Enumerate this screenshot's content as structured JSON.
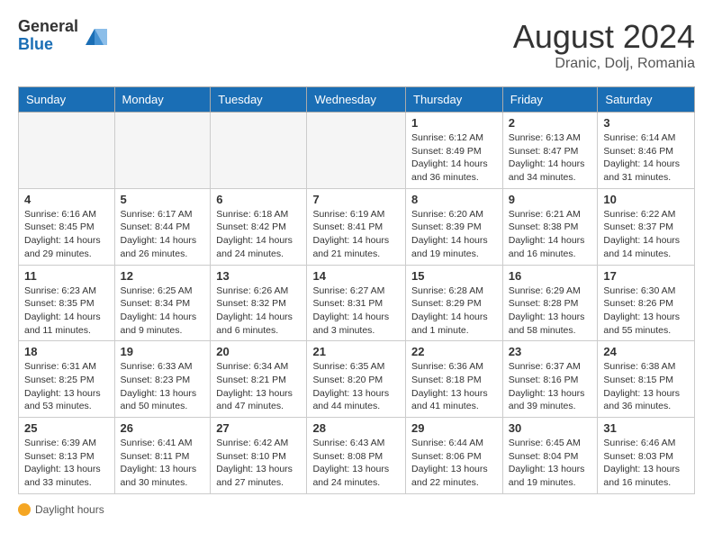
{
  "header": {
    "logo_general": "General",
    "logo_blue": "Blue",
    "month_year": "August 2024",
    "location": "Dranic, Dolj, Romania"
  },
  "calendar": {
    "days_of_week": [
      "Sunday",
      "Monday",
      "Tuesday",
      "Wednesday",
      "Thursday",
      "Friday",
      "Saturday"
    ],
    "weeks": [
      [
        {
          "day": "",
          "info": ""
        },
        {
          "day": "",
          "info": ""
        },
        {
          "day": "",
          "info": ""
        },
        {
          "day": "",
          "info": ""
        },
        {
          "day": "1",
          "info": "Sunrise: 6:12 AM\nSunset: 8:49 PM\nDaylight: 14 hours and 36 minutes."
        },
        {
          "day": "2",
          "info": "Sunrise: 6:13 AM\nSunset: 8:47 PM\nDaylight: 14 hours and 34 minutes."
        },
        {
          "day": "3",
          "info": "Sunrise: 6:14 AM\nSunset: 8:46 PM\nDaylight: 14 hours and 31 minutes."
        }
      ],
      [
        {
          "day": "4",
          "info": "Sunrise: 6:16 AM\nSunset: 8:45 PM\nDaylight: 14 hours and 29 minutes."
        },
        {
          "day": "5",
          "info": "Sunrise: 6:17 AM\nSunset: 8:44 PM\nDaylight: 14 hours and 26 minutes."
        },
        {
          "day": "6",
          "info": "Sunrise: 6:18 AM\nSunset: 8:42 PM\nDaylight: 14 hours and 24 minutes."
        },
        {
          "day": "7",
          "info": "Sunrise: 6:19 AM\nSunset: 8:41 PM\nDaylight: 14 hours and 21 minutes."
        },
        {
          "day": "8",
          "info": "Sunrise: 6:20 AM\nSunset: 8:39 PM\nDaylight: 14 hours and 19 minutes."
        },
        {
          "day": "9",
          "info": "Sunrise: 6:21 AM\nSunset: 8:38 PM\nDaylight: 14 hours and 16 minutes."
        },
        {
          "day": "10",
          "info": "Sunrise: 6:22 AM\nSunset: 8:37 PM\nDaylight: 14 hours and 14 minutes."
        }
      ],
      [
        {
          "day": "11",
          "info": "Sunrise: 6:23 AM\nSunset: 8:35 PM\nDaylight: 14 hours and 11 minutes."
        },
        {
          "day": "12",
          "info": "Sunrise: 6:25 AM\nSunset: 8:34 PM\nDaylight: 14 hours and 9 minutes."
        },
        {
          "day": "13",
          "info": "Sunrise: 6:26 AM\nSunset: 8:32 PM\nDaylight: 14 hours and 6 minutes."
        },
        {
          "day": "14",
          "info": "Sunrise: 6:27 AM\nSunset: 8:31 PM\nDaylight: 14 hours and 3 minutes."
        },
        {
          "day": "15",
          "info": "Sunrise: 6:28 AM\nSunset: 8:29 PM\nDaylight: 14 hours and 1 minute."
        },
        {
          "day": "16",
          "info": "Sunrise: 6:29 AM\nSunset: 8:28 PM\nDaylight: 13 hours and 58 minutes."
        },
        {
          "day": "17",
          "info": "Sunrise: 6:30 AM\nSunset: 8:26 PM\nDaylight: 13 hours and 55 minutes."
        }
      ],
      [
        {
          "day": "18",
          "info": "Sunrise: 6:31 AM\nSunset: 8:25 PM\nDaylight: 13 hours and 53 minutes."
        },
        {
          "day": "19",
          "info": "Sunrise: 6:33 AM\nSunset: 8:23 PM\nDaylight: 13 hours and 50 minutes."
        },
        {
          "day": "20",
          "info": "Sunrise: 6:34 AM\nSunset: 8:21 PM\nDaylight: 13 hours and 47 minutes."
        },
        {
          "day": "21",
          "info": "Sunrise: 6:35 AM\nSunset: 8:20 PM\nDaylight: 13 hours and 44 minutes."
        },
        {
          "day": "22",
          "info": "Sunrise: 6:36 AM\nSunset: 8:18 PM\nDaylight: 13 hours and 41 minutes."
        },
        {
          "day": "23",
          "info": "Sunrise: 6:37 AM\nSunset: 8:16 PM\nDaylight: 13 hours and 39 minutes."
        },
        {
          "day": "24",
          "info": "Sunrise: 6:38 AM\nSunset: 8:15 PM\nDaylight: 13 hours and 36 minutes."
        }
      ],
      [
        {
          "day": "25",
          "info": "Sunrise: 6:39 AM\nSunset: 8:13 PM\nDaylight: 13 hours and 33 minutes."
        },
        {
          "day": "26",
          "info": "Sunrise: 6:41 AM\nSunset: 8:11 PM\nDaylight: 13 hours and 30 minutes."
        },
        {
          "day": "27",
          "info": "Sunrise: 6:42 AM\nSunset: 8:10 PM\nDaylight: 13 hours and 27 minutes."
        },
        {
          "day": "28",
          "info": "Sunrise: 6:43 AM\nSunset: 8:08 PM\nDaylight: 13 hours and 24 minutes."
        },
        {
          "day": "29",
          "info": "Sunrise: 6:44 AM\nSunset: 8:06 PM\nDaylight: 13 hours and 22 minutes."
        },
        {
          "day": "30",
          "info": "Sunrise: 6:45 AM\nSunset: 8:04 PM\nDaylight: 13 hours and 19 minutes."
        },
        {
          "day": "31",
          "info": "Sunrise: 6:46 AM\nSunset: 8:03 PM\nDaylight: 13 hours and 16 minutes."
        }
      ]
    ]
  },
  "footer": {
    "daylight_label": "Daylight hours"
  }
}
